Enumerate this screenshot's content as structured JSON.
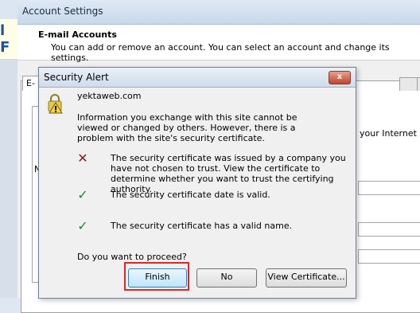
{
  "background": {
    "window_fragment_text": "l F"
  },
  "account_settings": {
    "title": "Account Settings",
    "heading": "E-mail Accounts",
    "subtitle": "You can add or remove an account. You can select an account and change its settings.",
    "tab_first_label": "E-",
    "right_text": "your Internet se",
    "left_stub": "N"
  },
  "security_alert": {
    "title": "Security Alert",
    "close_label": "x",
    "site": "yektaweb.com",
    "info": "Information you exchange with this site cannot be viewed or changed by others. However, there is a problem with the site's security certificate.",
    "checks": [
      {
        "status": "fail",
        "icon": "red-x-icon",
        "text": "The security certificate was issued by a company you have not chosen to trust. View the certificate to determine whether you want to trust the certifying authority."
      },
      {
        "status": "ok",
        "icon": "green-check-icon",
        "text": "The security certificate date is valid."
      },
      {
        "status": "ok",
        "icon": "green-check-icon",
        "text": "The security certificate has a valid name."
      }
    ],
    "question": "Do you want to proceed?",
    "buttons": {
      "finish": "Finish",
      "no": "No",
      "view_certificate": "View Certificate..."
    }
  },
  "colors": {
    "highlight_frame": "#d42a2a",
    "fail_icon": "#8a1a1a",
    "ok_icon": "#1a8a2a"
  }
}
